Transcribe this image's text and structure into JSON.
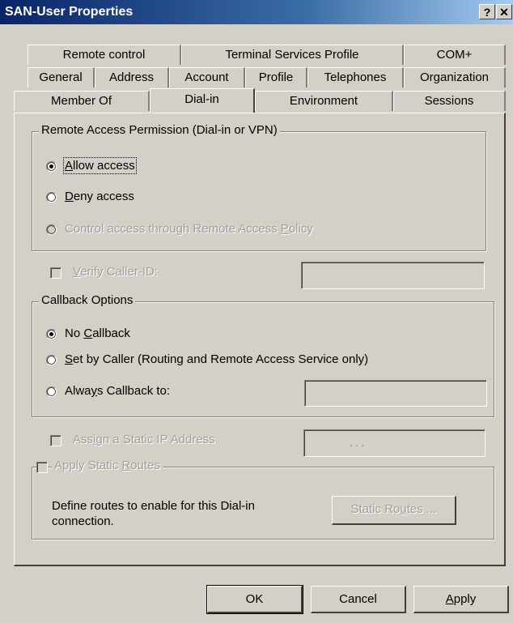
{
  "window": {
    "title": "SAN-User Properties",
    "help_btn": "?",
    "close_btn": "✕"
  },
  "tabs": {
    "row1": [
      "Remote control",
      "Terminal Services Profile",
      "COM+"
    ],
    "row2": [
      "General",
      "Address",
      "Account",
      "Profile",
      "Telephones",
      "Organization"
    ],
    "row3": [
      "Member Of",
      "Dial-in",
      "Environment",
      "Sessions"
    ],
    "active": "Dial-in"
  },
  "remote_access": {
    "legend": "Remote Access Permission (Dial-in or VPN)",
    "allow": {
      "pre": "",
      "u": "A",
      "post": "llow access"
    },
    "deny": {
      "pre": "",
      "u": "D",
      "post": "eny access"
    },
    "policy": {
      "pre": "Control access through Remote Access ",
      "u": "P",
      "post": "olicy"
    },
    "selected": "allow"
  },
  "verify": {
    "pre": "",
    "u": "V",
    "post": "erify Caller-ID:",
    "value": ""
  },
  "callback": {
    "legend": "Callback Options",
    "none": {
      "pre": "No ",
      "u": "C",
      "post": "allback"
    },
    "caller": {
      "pre": "",
      "u": "S",
      "post": "et by Caller (Routing and Remote Access Service only)"
    },
    "always": {
      "pre": "Alwa",
      "u": "y",
      "post": "s Callback to:"
    },
    "selected": "none",
    "always_value": ""
  },
  "static_ip": {
    "pre": "Ass",
    "u": "i",
    "post": "gn a Static IP Address",
    "ip_placeholder": ".  .  ."
  },
  "static_routes": {
    "pre": "Apply Static ",
    "u": "R",
    "post": "outes",
    "description": "Define routes to enable for this Dial-in connection.",
    "button": {
      "pre": "Static Ro",
      "u": "u",
      "post": "tes ..."
    }
  },
  "buttons": {
    "ok": "OK",
    "cancel": "Cancel",
    "apply": {
      "pre": "",
      "u": "A",
      "post": "pply"
    }
  }
}
